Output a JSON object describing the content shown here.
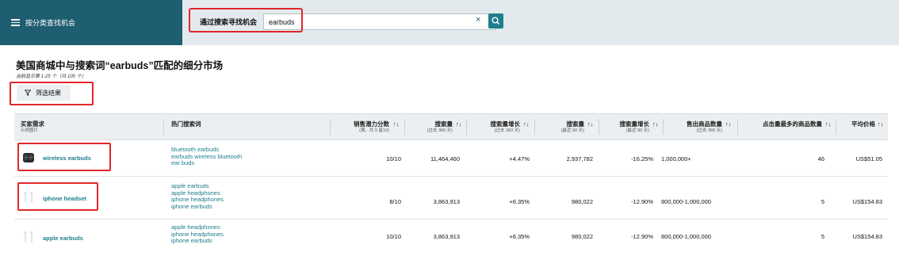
{
  "header": {
    "menu_label": "按分类查找机会",
    "search_label": "通过搜索寻找机会",
    "search_value": "earbuds",
    "clear_icon": "×"
  },
  "page": {
    "title": "美国商城中与搜索词“earbuds”匹配的细分市场",
    "subtitle": "当前显示第 1-25 个（共 105 个）",
    "filter_label": "筛选结果"
  },
  "table": {
    "columns": [
      {
        "label": "买家需求",
        "sub": "示例图片"
      },
      {
        "label": "热门搜索词",
        "sub": ""
      },
      {
        "label": "销售潜力分数",
        "sub": "(满，共 5 星10)"
      },
      {
        "label": "搜索量",
        "sub": "(过去 360 天)"
      },
      {
        "label": "搜索量增长",
        "sub": "(过去 360 天)"
      },
      {
        "label": "搜索量",
        "sub": "(最近 90 天)"
      },
      {
        "label": "搜索量增长",
        "sub": "(最近 90 天)"
      },
      {
        "label": "售出商品数量",
        "sub": "(过去 360 天)"
      },
      {
        "label": "点击量最多的商品数量",
        "sub": ""
      },
      {
        "label": "平均价格",
        "sub": ""
      }
    ],
    "sort_icon": "↑↓",
    "rows": [
      {
        "demand": "wireless earbuds",
        "terms": [
          "bluetooth earbuds",
          "earbuds wireless bluetooth",
          "ear buds"
        ],
        "score": "10/10",
        "search_360": "11,464,460",
        "growth_360": "+4.47%",
        "search_90": "2,937,782",
        "growth_90": "-16.25%",
        "units_sold": "1,000,000+",
        "clicked": "46",
        "price": "US$51.05"
      },
      {
        "demand": "iphone headset",
        "terms": [
          "apple earbuds",
          "apple headphones",
          "iphone headphones",
          "iphone earbuds"
        ],
        "score": "8/10",
        "search_360": "3,863,913",
        "growth_360": "+6.35%",
        "search_90": "980,022",
        "growth_90": "-12.90%",
        "units_sold": "800,000-1,000,000",
        "clicked": "5",
        "price": "US$154.83"
      },
      {
        "demand": "apple earbuds",
        "terms": [
          "apple headphones",
          "iphone headphones",
          "iphone earbuds"
        ],
        "score": "10/10",
        "search_360": "3,863,913",
        "growth_360": "+6.35%",
        "search_90": "980,022",
        "growth_90": "-12.90%",
        "units_sold": "800,000-1,000,000",
        "clicked": "5",
        "price": "US$154.83"
      }
    ]
  },
  "colors": {
    "brand_teal": "#1f5d70",
    "link_teal": "#1e7e8c",
    "highlight_red": "#e0262b"
  }
}
